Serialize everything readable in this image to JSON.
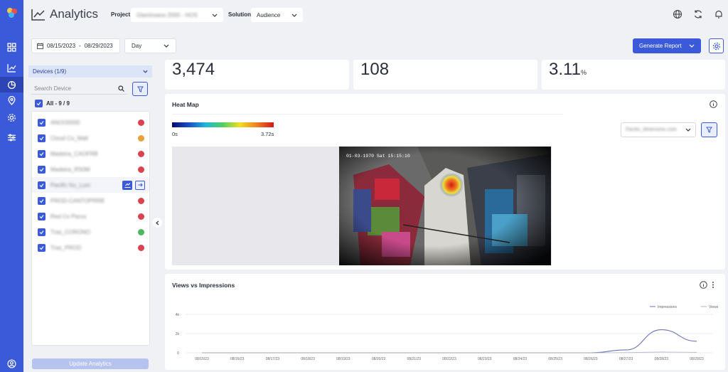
{
  "header": {
    "title": "Analytics",
    "project_label": "Project",
    "project_value": "Glamhoano 2000 - HOS",
    "solution_label": "Solution",
    "solution_value": "Audience"
  },
  "toolbar": {
    "date_start": "08/15/2023",
    "date_sep": "-",
    "date_end": "08/29/2023",
    "granularity": "Day",
    "generate_label": "Generate Report"
  },
  "devices": {
    "header": "Devices (1/9)",
    "search_placeholder": "Search Device",
    "all_label": "All - 9 / 9",
    "items": [
      {
        "name": "ANOO0000",
        "status": "red"
      },
      {
        "name": "Cloud Co_Malt",
        "status": "orange"
      },
      {
        "name": "Madeira_CAOFRB",
        "status": "red"
      },
      {
        "name": "Madeira_RS0M",
        "status": "red"
      },
      {
        "name": "Pacific No_Lum",
        "status": "none"
      },
      {
        "name": "PROD-CANTOPRRB",
        "status": "red"
      },
      {
        "name": "Red Co Parus",
        "status": "red"
      },
      {
        "name": "Tras_CORONO",
        "status": "green"
      },
      {
        "name": "Tras_PROD",
        "status": "red"
      }
    ],
    "update_label": "Update Analytics"
  },
  "stats": {
    "views": "3,474",
    "impressions": "108",
    "rate_value": "3.11",
    "rate_unit": "%"
  },
  "heatmap": {
    "title": "Heat Map",
    "legend_min": "0s",
    "legend_max": "3.72s",
    "device_select": "Pacific_Mnemonic.com",
    "camera_timestamp": "01-03-1970 Sat 15:15:10"
  },
  "colors": {
    "accent": "#3a5ad9",
    "status_red": "#d9434f",
    "status_orange": "#eaa13a",
    "status_green": "#4cb85c"
  },
  "chart_data": {
    "type": "line",
    "title": "Views vs Impressions",
    "legend_placement": "top-right",
    "series": [
      {
        "name": "Impressions",
        "values": [
          0,
          0,
          0,
          0,
          0,
          0,
          0,
          0,
          0,
          0,
          0,
          0,
          0.3,
          2.4,
          1.2
        ]
      },
      {
        "name": "Views",
        "values": [
          0,
          0,
          0,
          0,
          0,
          0,
          0,
          0,
          0,
          0,
          0,
          0,
          0.02,
          0.08,
          0.05
        ]
      }
    ],
    "categories": [
      "08/15/23",
      "08/16/23",
      "08/17/23",
      "08/18/23",
      "08/19/23",
      "08/20/23",
      "08/21/23",
      "08/22/23",
      "08/23/23",
      "08/24/23",
      "08/25/23",
      "08/26/23",
      "08/27/23",
      "08/28/23",
      "08/29/23"
    ],
    "yticks": [
      "4k",
      "2k",
      "0"
    ],
    "ylim": [
      0,
      4000
    ],
    "grid": true
  }
}
